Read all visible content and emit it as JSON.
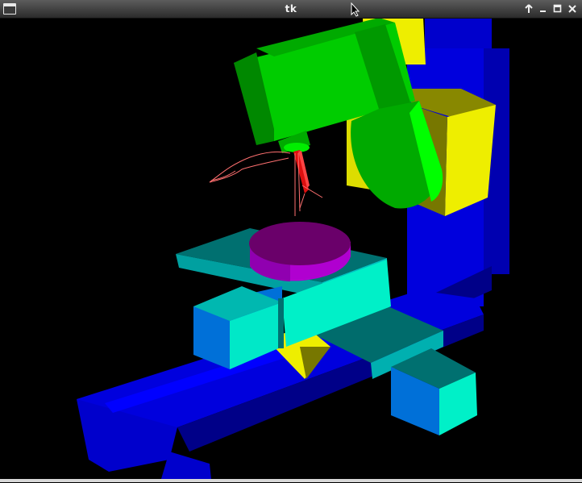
{
  "window": {
    "title": "tk",
    "buttons": [
      "sticky-up-icon",
      "minimize-icon",
      "maximize-icon",
      "close-icon"
    ]
  },
  "scene": {
    "description_colors": {
      "base": "#0000dd",
      "column": "#0000dd",
      "saddle": "#006c6c",
      "table": "#00f0c8",
      "block": "#0070d8",
      "head_arm": "#00cc00",
      "yellow": "#eeee00",
      "workpiece": "#b000d0",
      "toolpath": "#ff7070",
      "tool": "#dd1010"
    }
  }
}
